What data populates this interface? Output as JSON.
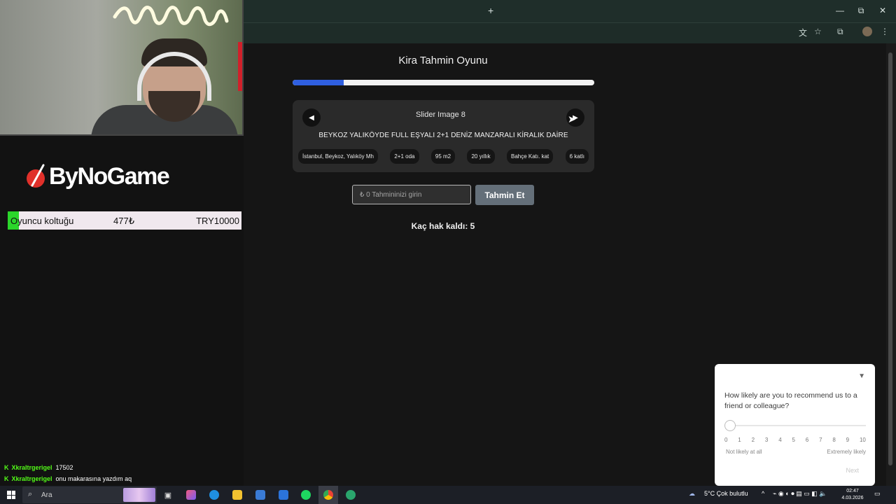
{
  "browser": {
    "new_tab_glyph": "+",
    "window_controls": {
      "minimize": "—",
      "maximize": "⧉",
      "close": "✕"
    },
    "toolbar_icons": [
      "translate-icon",
      "bookmark-star-icon",
      "extensions-icon",
      "profile-avatar",
      "menu-icon"
    ]
  },
  "game": {
    "title": "Kira Tahmin Oyunu",
    "progress_fraction": 0.17,
    "slider": {
      "prev_glyph": "◀",
      "next_glyph": "▶",
      "image_alt": "Slider Image 8"
    },
    "listing_title": "BEYKOZ YALIKÖYDE FULL EŞYALI 2+1 DENİZ MANZARALI KİRALIK DAİRE",
    "tags": [
      "İstanbul, Beykoz, Yalıköy Mh",
      "2+1 oda",
      "95 m2",
      "20 yıllık",
      "Bahçe Katı. kat",
      "6 katlı"
    ],
    "guess_placeholder": "₺ 0 Tahmininizi girin",
    "guess_button": "Tahmin Et",
    "remaining_text": "Kaç hak kaldı: 5"
  },
  "survey": {
    "question": "How likely are you to recommend us to a friend or colleague?",
    "scale": [
      "0",
      "1",
      "2",
      "3",
      "4",
      "5",
      "6",
      "7",
      "8",
      "9",
      "10"
    ],
    "low_label": "Not likely at all",
    "high_label": "Extremely likely",
    "next_button": "Next"
  },
  "overlay": {
    "logo_text": "ByNoGame",
    "seat": {
      "label": "Oyuncu koltuğu",
      "price": "477₺",
      "total": "TRY10000"
    },
    "chat": [
      {
        "user": "Xkraltrgerigel",
        "message": "17502"
      },
      {
        "user": "Xkraltrgerigel",
        "message": "onu makarasına yazdım aq"
      }
    ],
    "chat_badge": "K"
  },
  "taskbar": {
    "search_placeholder": "Ara",
    "weather": "5°C  Çok bulutlu",
    "time": "02:47",
    "date": "4.03.2026"
  },
  "colors": {
    "progress": "#2f5fe0",
    "guess_button": "#646f79",
    "chat_user": "#53fc18",
    "seat_green": "#2bd62b"
  }
}
